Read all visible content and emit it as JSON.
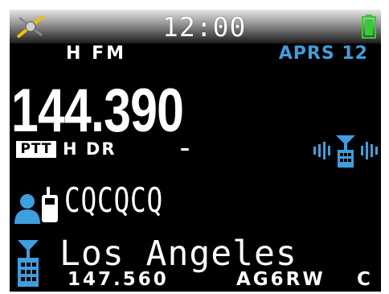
{
  "status_bar": {
    "clock": "12:00",
    "icons": {
      "satellite": "satellite-gps-icon",
      "battery": "battery-full-icon"
    },
    "colors": {
      "satellite": "#f0c000",
      "battery": "#2ed12e"
    }
  },
  "mode_row": {
    "power_mode": "H FM",
    "aprs": "APRS 12",
    "aprs_color": "#3d9fe0"
  },
  "main": {
    "frequency": "144.390"
  },
  "status_row": {
    "ptt_badge": "PTT",
    "power_dr": "H DR",
    "dash": "–",
    "signal_icon": "repeater-signal-icon"
  },
  "to_call": {
    "icon": "radio-user-icon",
    "value": "CQCQCQ",
    "icon_color": "#3d9fe0"
  },
  "repeater": {
    "icon": "repeater-icon",
    "name": "Los Angeles",
    "frequency": "147.560",
    "callsign": "AG6RW",
    "module": "C"
  }
}
